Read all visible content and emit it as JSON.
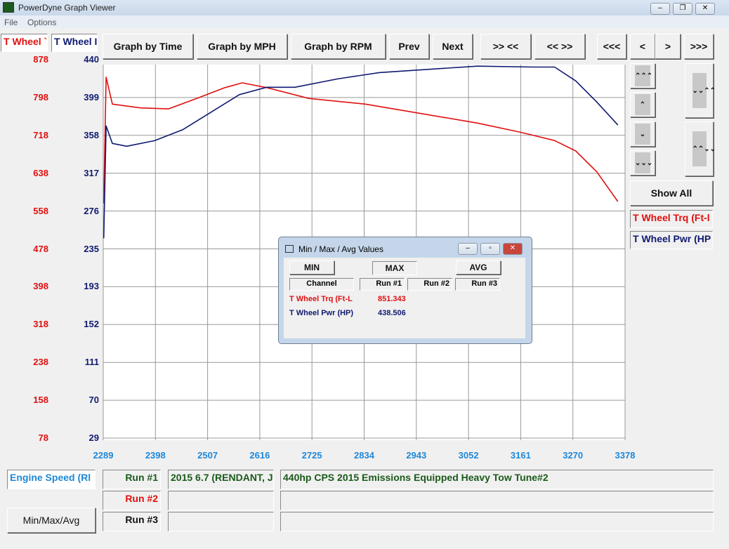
{
  "window": {
    "title": "PowerDyne Graph Viewer",
    "controls": [
      "–",
      "❐",
      "✕"
    ]
  },
  "menu": [
    "File",
    "Options"
  ],
  "channel_tabs": [
    "T Wheel Trq (Ft-Lbs)",
    "T Wheel Pwr (HP)"
  ],
  "channel_tabs_visible": [
    "T Wheel `",
    "T Wheel I"
  ],
  "toolbar": {
    "time": "Graph by Time",
    "mph": "Graph by MPH",
    "rpm": "Graph by RPM",
    "prev": "Prev",
    "next": "Next",
    "zoom_in": ">> <<",
    "zoom_out": "<< >>",
    "first": "<<<",
    "left": "<",
    "right": ">",
    "last": ">>>"
  },
  "right_panel": {
    "show_all": "Show All",
    "legend": [
      "T Wheel Trq (Ft-l",
      "T Wheel Pwr (HP"
    ],
    "scroll_up_fast": "⌃⌃⌃",
    "scroll_up": "⌃",
    "scroll_down": "⌄",
    "scroll_down_fast": "⌄⌄⌄",
    "expand": "⌄⌄⌃⌃",
    "compress": "⌃⌃⌄⌄"
  },
  "chart_data": {
    "type": "line",
    "xlabel": "Engine Speed (RPM)",
    "x_ticks": [
      "2289",
      "2398",
      "2507",
      "2616",
      "2725",
      "2834",
      "2943",
      "3052",
      "3161",
      "3270",
      "3378"
    ],
    "xlim": [
      2289,
      3378
    ],
    "y_left_ticks": [
      "878",
      "798",
      "718",
      "638",
      "558",
      "478",
      "398",
      "318",
      "238",
      "158",
      "78"
    ],
    "y_left_lim": [
      78,
      878
    ],
    "y_right_ticks": [
      "440",
      "399",
      "358",
      "317",
      "276",
      "235",
      "193",
      "152",
      "111",
      "70",
      "29"
    ],
    "y_right_lim": [
      29,
      440
    ],
    "grid": true,
    "series": [
      {
        "name": "T Wheel Trq (Ft-Lbs)",
        "color": "#e01010",
        "axis": "left",
        "x": [
          2290,
          2295,
          2308,
          2367,
          2425,
          2484,
          2543,
          2579,
          2630,
          2718,
          2836,
          2953,
          3070,
          3158,
          3231,
          3275,
          3319,
          3363
        ],
        "y": [
          574,
          841,
          784,
          776,
          774,
          796,
          819,
          829,
          819,
          796,
          784,
          764,
          744,
          725,
          707,
          685,
          641,
          578
        ]
      },
      {
        "name": "T Wheel Pwr (HP)",
        "color": "#101a70",
        "axis": "right",
        "x": [
          2290,
          2295,
          2308,
          2338,
          2396,
          2455,
          2514,
          2573,
          2630,
          2689,
          2777,
          2865,
          2953,
          3070,
          3187,
          3231,
          3275,
          3319,
          3363
        ],
        "y": [
          246,
          368,
          349,
          346,
          352,
          364,
          383,
          402,
          410,
          410,
          419,
          426,
          429,
          433,
          432,
          432,
          417,
          394,
          369
        ]
      }
    ]
  },
  "dialog": {
    "title": "Min / Max / Avg Values",
    "min": "MIN",
    "max": "MAX",
    "avg": "AVG",
    "headers": [
      "Channel",
      "Run #1",
      "Run #2",
      "Run #3"
    ],
    "rows": [
      {
        "channel": "T Wheel Trq (Ft-L",
        "run1": "851.343",
        "color": "#e01010"
      },
      {
        "channel": "T Wheel Pwr (HP)",
        "run1": "438.506",
        "color": "#101a70"
      }
    ]
  },
  "bottom": {
    "x_channel": "Engine Speed (Rl",
    "minmaxavg": "Min/Max/Avg",
    "runs": [
      {
        "label": "Run #1",
        "name": "2015 6.7 (RENDANT, J",
        "desc": "440hp CPS 2015 Emissions Equipped Heavy Tow Tune#2",
        "color": "#1a5a1a"
      },
      {
        "label": "Run #2",
        "name": "",
        "desc": "",
        "color": "#e01010"
      },
      {
        "label": "Run #3",
        "name": "",
        "desc": "",
        "color": "#111"
      }
    ]
  }
}
